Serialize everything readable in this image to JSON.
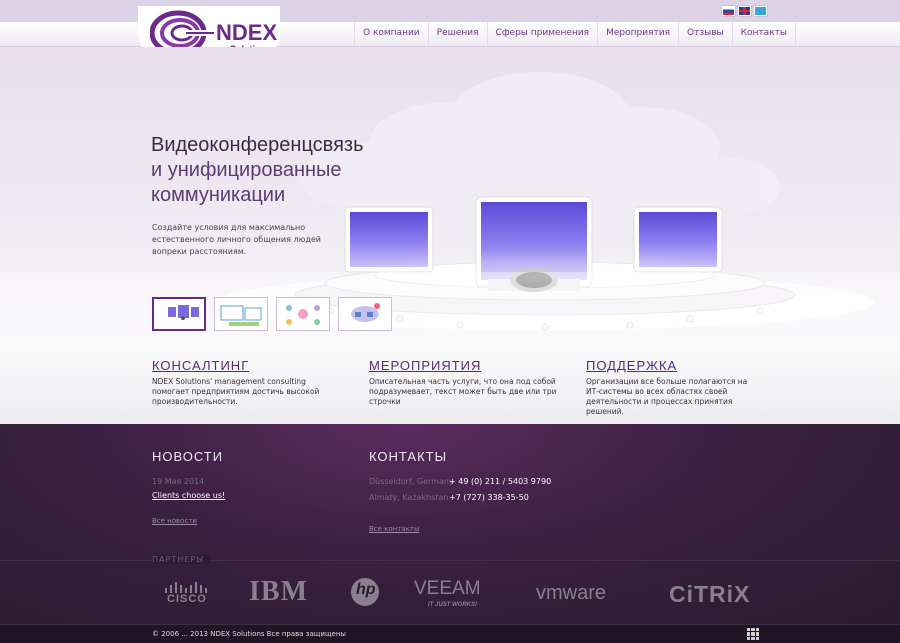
{
  "header": {
    "brand_name": "NDEX",
    "brand_sub": "Solutions",
    "nav": [
      "О компании",
      "Решения",
      "Сферы применения",
      "Мероприятия",
      "Отзывы",
      "Контакты"
    ],
    "flags": [
      "ru-flag-icon",
      "en-flag-icon",
      "kz-flag-icon"
    ]
  },
  "hero": {
    "title_line1": "Видеоконференцсвязь",
    "title_line2": "и унифицированные",
    "title_line3": "коммуникации",
    "description": "Создайте условия для максимально естественного личного общения людей вопреки расстояниям.",
    "thumbnails": 4,
    "active_thumbnail": 1
  },
  "features": [
    {
      "title": "КОНСАЛТИНГ",
      "text": "NDEX Solutions' management consulting помогает предприятиям достичь высокой производительности."
    },
    {
      "title": "МЕРОПРИЯТИЯ",
      "text": "Описательная часть услуги, что она под собой подразумевает, текст может быть две или три строчки"
    },
    {
      "title": "ПОДДЕРЖКА",
      "text": "Организации все больше полагаются на ИТ-системы во всех областях своей деятельности и процессах принятия решений."
    }
  ],
  "news": {
    "title": "НОВОСТИ",
    "date": "19 Мая 2014",
    "link": "Clients choose us!",
    "all_link": "Все новости"
  },
  "contacts": {
    "title": "КОНТАКТЫ",
    "rows": [
      {
        "city": "Düsseldorf, Germany",
        "phone": "+ 49 (0) 211 / 5403 9790"
      },
      {
        "city": "Almaty, Kazakhstan",
        "phone": "+7 (727) 338-35-50"
      }
    ],
    "all_link": "Все контакты"
  },
  "partners": {
    "label": "ПАРТНЕРЫ",
    "logos": [
      "CISCO",
      "IBM",
      "hp",
      "VEEAM",
      "IT JUST WORKS!",
      "vmware",
      "CiTRiX"
    ]
  },
  "footer": {
    "copyright": "© 2006 ... 2013 NDEX Solutions Все права защищены"
  },
  "colors": {
    "brand": "#6b2a8a",
    "footer_bg": "#2a1a30",
    "hero_bg": "#e7e0ec"
  }
}
